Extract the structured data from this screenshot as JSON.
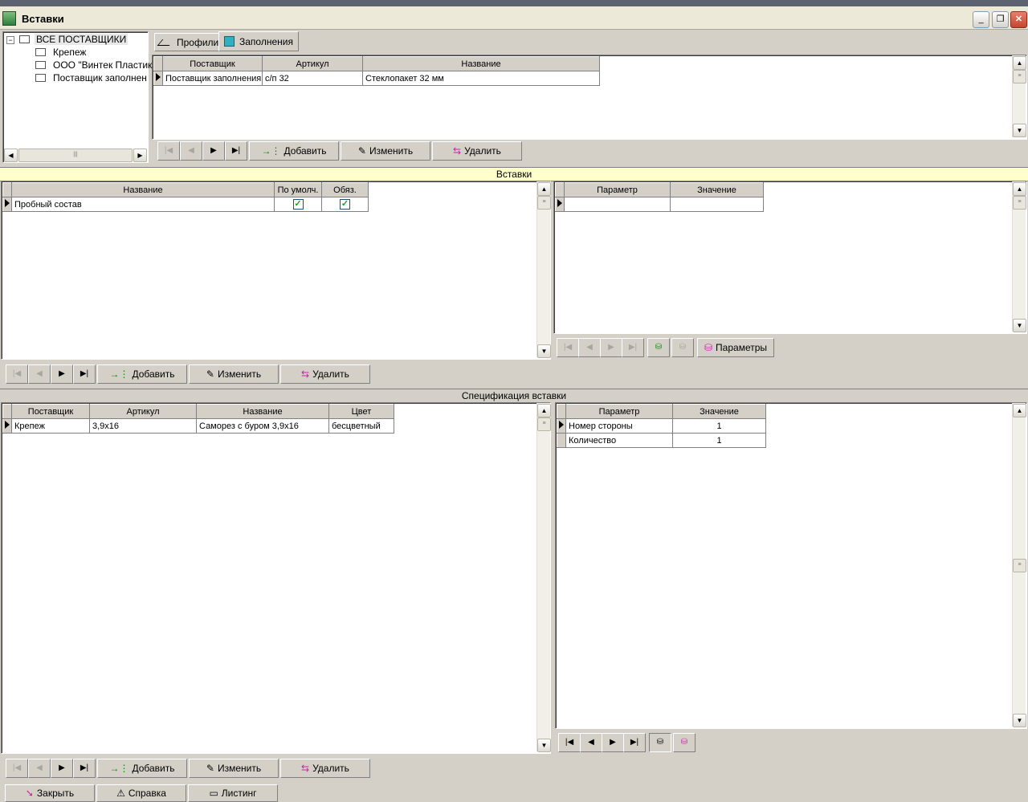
{
  "window": {
    "title": "Вставки"
  },
  "tree": {
    "root": "ВСЕ ПОСТАВЩИКИ",
    "items": [
      "Крепеж",
      "ООО \"Винтек Пластик\"",
      "Поставщик заполнения"
    ]
  },
  "tabs": [
    {
      "label": "Профили"
    },
    {
      "label": "Заполнения"
    }
  ],
  "supplier_grid": {
    "columns": [
      "Поставщик",
      "Артикул",
      "Название"
    ],
    "rows": [
      [
        "Поставщик заполнения",
        "с/п 32",
        "Стеклопакет 32 мм"
      ]
    ]
  },
  "actions": {
    "add": "Добавить",
    "edit": "Изменить",
    "delete": "Удалить",
    "parameters": "Параметры"
  },
  "inserts": {
    "title": "Вставки",
    "columns": [
      "Название",
      "По умолч.",
      "Обяз."
    ],
    "rows": [
      {
        "name": "Пробный состав",
        "default": true,
        "required": true
      }
    ]
  },
  "insert_params": {
    "columns": [
      "Параметр",
      "Значение"
    ]
  },
  "spec": {
    "title": "Спецификация  вставки",
    "columns": [
      "Поставщик",
      "Артикул",
      "Название",
      "Цвет"
    ],
    "rows": [
      [
        "Крепеж",
        "3,9x16",
        "Саморез с буром 3,9x16",
        "бесцветный"
      ]
    ]
  },
  "spec_params": {
    "columns": [
      "Параметр",
      "Значение"
    ],
    "rows": [
      [
        "Номер стороны",
        "1"
      ],
      [
        "Количество",
        "1"
      ]
    ]
  },
  "footer": {
    "close": "Закрыть",
    "help": "Справка",
    "listing": "Листинг"
  },
  "colors": {
    "section_bar": "#ffffcc",
    "window_bg": "#d4d0c8",
    "close_button": "#c5452f"
  }
}
